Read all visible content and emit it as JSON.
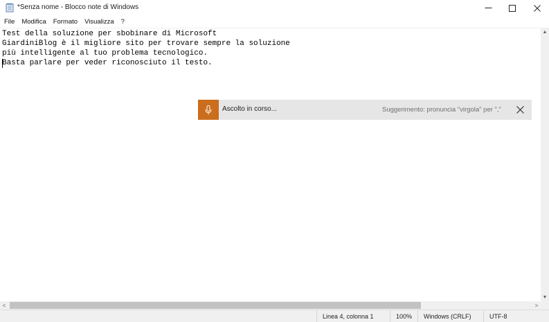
{
  "window": {
    "title": "*Senza nome - Blocco note di Windows",
    "controls": {
      "minimize": "—",
      "maximize": "☐",
      "close": "✕"
    }
  },
  "menu": [
    "File",
    "Modifica",
    "Formato",
    "Visualizza",
    "?"
  ],
  "editor": {
    "lines": [
      "Test della soluzione per sbobinare di Microsoft",
      "GiardiniBlog è il migliore sito per trovare sempre la soluzione",
      "più intelligente al tuo problema tecnologico.",
      "Basta parlare per veder riconosciuto il testo."
    ]
  },
  "dictation": {
    "status": "Ascolto in corso...",
    "hint": "Suggerimento: pronuncia \"virgola\" per \",\"",
    "accent_color": "#ca6d1c",
    "mic_icon": "microphone-icon",
    "close_icon": "close-icon"
  },
  "scrollbars": {
    "left_arrow": "<",
    "right_arrow": ">",
    "up_arrow": "▲",
    "down_arrow": "▼"
  },
  "status": {
    "position": "Linea 4, colonna 1",
    "zoom": "100%",
    "line_ending": "Windows (CRLF)",
    "encoding": "UTF-8"
  }
}
